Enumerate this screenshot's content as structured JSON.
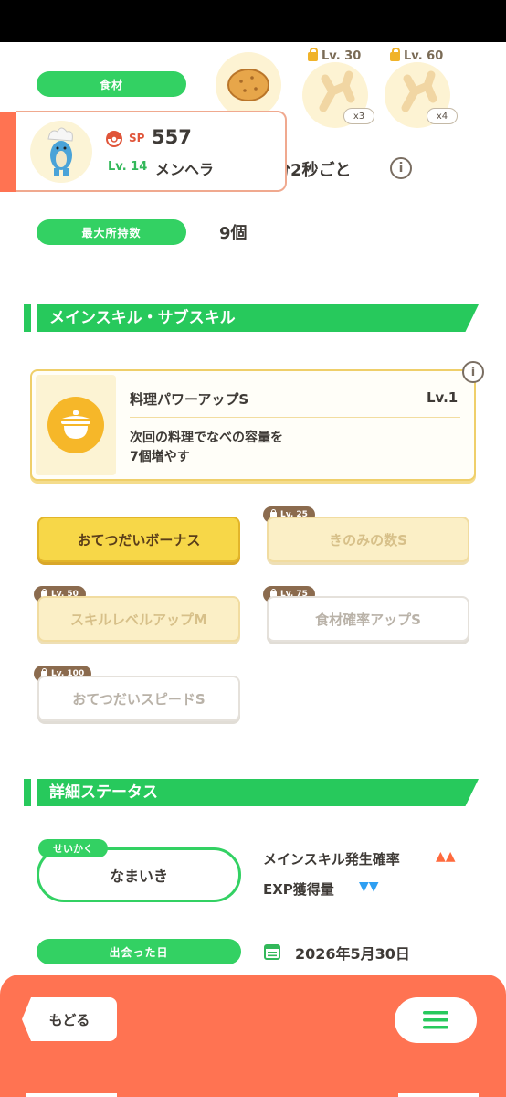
{
  "ingredients": {
    "label": "食材",
    "slots": [
      {
        "icon": "potato-icon",
        "lock": "",
        "count": ""
      },
      {
        "icon": "ginger-icon",
        "lock": "Lv. 30",
        "count": "x3"
      },
      {
        "icon": "ginger-icon",
        "lock": "Lv. 60",
        "count": "x4"
      }
    ]
  },
  "pokemon_card": {
    "sp_label": "SP",
    "sp_value": "557",
    "level": "Lv. 14",
    "name": "メンヘラ"
  },
  "help_interval_partial": "分2秒ごと",
  "max_carry": {
    "label": "最大所持数",
    "value": "9個"
  },
  "skills_section": {
    "title": "メインスキル・サブスキル",
    "main_skill": {
      "name": "料理パワーアップS",
      "level": "Lv.1",
      "desc_line1": "次回の料理でなべの容量を",
      "desc_line2": "7個増やす"
    },
    "sub_skills": [
      {
        "label": "おてつだいボーナス",
        "lock": ""
      },
      {
        "label": "きのみの数S",
        "lock": "Lv. 25"
      },
      {
        "label": "スキルレベルアップM",
        "lock": "Lv. 50"
      },
      {
        "label": "食材確率アップS",
        "lock": "Lv. 75"
      },
      {
        "label": "おてつだいスピードS",
        "lock": "Lv. 100"
      }
    ]
  },
  "detail_section": {
    "title": "詳細ステータス",
    "nature_tag": "せいかく",
    "nature": "なまいき",
    "stat_up": "メインスキル発生確率",
    "stat_up_arrows": "▲▲",
    "stat_down": "EXP獲得量",
    "stat_down_arrows": "▼▼",
    "met_label": "出会った日",
    "met_date": "2026年5月30日"
  },
  "footer": {
    "back_label": "もどる",
    "menu_icon": "hamburger-menu-icon"
  },
  "colors": {
    "green": "#33d163",
    "footer": "#ff7352",
    "card_border": "#f0a98f",
    "skill_gold": "#f7d748",
    "up": "#ff6a3d",
    "down": "#2e9ff2"
  }
}
